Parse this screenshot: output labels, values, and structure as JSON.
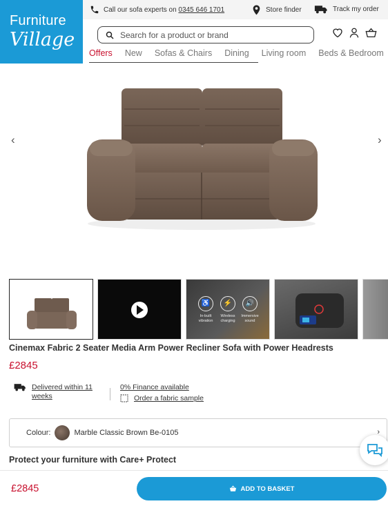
{
  "brand": {
    "line1": "Furniture",
    "line2": "Village",
    "color": "#1b9ad6"
  },
  "topbar": {
    "call_prefix": "Call our ",
    "call_bold": "sofa experts",
    "call_mid": " on ",
    "phone": "0345 646 1701",
    "store_finder": "Store finder",
    "track_order": "Track my order"
  },
  "search": {
    "placeholder": "Search for a product or brand"
  },
  "nav": {
    "items": [
      "Offers",
      "New",
      "Sofas & Chairs",
      "Dining",
      "Living room",
      "Beds & Bedroom"
    ],
    "active_color": "#c8102e"
  },
  "thumbs": {
    "features": [
      "In-built vibration",
      "Wireless charging",
      "Immersive sound"
    ]
  },
  "product": {
    "title": "Cinemax Fabric 2 Seater Media Arm Power Recliner Sofa with Power Headrests",
    "price": "£2845",
    "delivery": "Delivered within 11 weeks",
    "finance": "0% Finance available",
    "sample": "Order a fabric sample",
    "colour_label": "Colour:",
    "colour_value": "Marble Classic Brown Be-0105"
  },
  "care": {
    "heading": "Protect your furniture with Care+ Protect"
  },
  "bottom": {
    "price": "£2845",
    "add_label": "ADD TO BASKET"
  }
}
